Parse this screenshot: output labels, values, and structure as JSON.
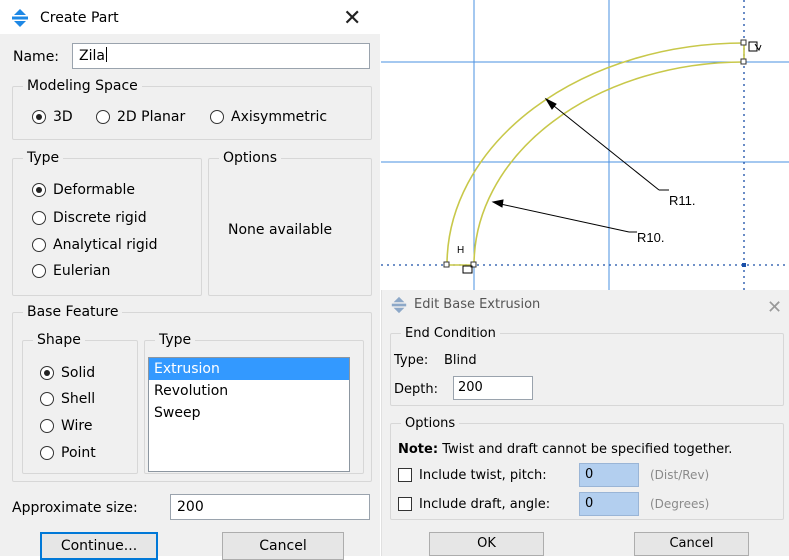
{
  "create_part": {
    "title": "Create Part",
    "close_glyph": "✕",
    "name_label": "Name:",
    "name_value": "Zila",
    "modeling_space": {
      "legend": "Modeling Space",
      "options": [
        "3D",
        "2D Planar",
        "Axisymmetric"
      ],
      "selected": "3D"
    },
    "type_group": {
      "legend": "Type",
      "options": [
        "Deformable",
        "Discrete rigid",
        "Analytical rigid",
        "Eulerian"
      ],
      "selected": "Deformable"
    },
    "options_group": {
      "legend": "Options",
      "text": "None available"
    },
    "base_feature": {
      "legend": "Base Feature",
      "shape_legend": "Shape",
      "shape_options": [
        "Solid",
        "Shell",
        "Wire",
        "Point"
      ],
      "shape_selected": "Solid",
      "type_legend": "Type",
      "type_items": [
        "Extrusion",
        "Revolution",
        "Sweep"
      ],
      "type_selected": "Extrusion"
    },
    "approx_size_label": "Approximate size:",
    "approx_size_value": "200",
    "continue_label": "Continue...",
    "cancel_label": "Cancel"
  },
  "sketch": {
    "vertex_label": "H",
    "dim_labels": [
      "R11.",
      "R10."
    ],
    "arc_color": "#c8c84a",
    "grid_color": "#4a90e2",
    "point_color": "#1a4fa8"
  },
  "edit_extrusion": {
    "title": "Edit Base Extrusion",
    "close_glyph": "✕",
    "end_condition": {
      "legend": "End Condition",
      "type_label": "Type:",
      "type_value": "Blind",
      "depth_label": "Depth:",
      "depth_value": "200"
    },
    "options": {
      "legend": "Options",
      "note_bold": "Note:",
      "note_text": "Twist and draft cannot be specified together.",
      "twist_label": "Include twist, pitch:",
      "twist_value": "0",
      "twist_unit": "(Dist/Rev)",
      "draft_label": "Include draft, angle:",
      "draft_value": "0",
      "draft_unit": "(Degrees)"
    },
    "ok_label": "OK",
    "cancel_label": "Cancel"
  },
  "colors": {
    "accent": "#0078d7",
    "list_selection": "#3399ff",
    "blue_input": "#b3cfef"
  }
}
